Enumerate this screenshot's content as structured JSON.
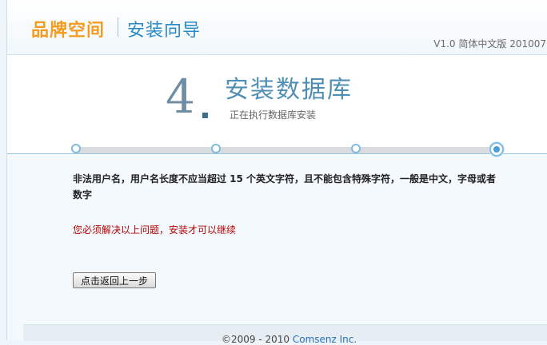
{
  "header": {
    "brand": "品牌空间",
    "wizard": "安装向导",
    "version": "V1.0 简体中文版 201007"
  },
  "step": {
    "number": "4",
    "title": "安装数据库",
    "subtitle": "正在执行数据库安装"
  },
  "progress": {
    "total_steps": 4,
    "current_step": 4
  },
  "messages": {
    "error": "非法用户名，用户名长度不应当超过 15 个英文字符，且不能包含特殊字符，一般是中文，字母或者数字",
    "warning": "您必须解决以上问题，安装才可以继续"
  },
  "buttons": {
    "back": "点击返回上一步"
  },
  "footer": {
    "copyright": "©2009 - 2010 ",
    "company": "Comsenz Inc."
  },
  "colors": {
    "accent": "#2a8ac5",
    "brand": "#f39c1f",
    "error_text": "#b30000"
  }
}
